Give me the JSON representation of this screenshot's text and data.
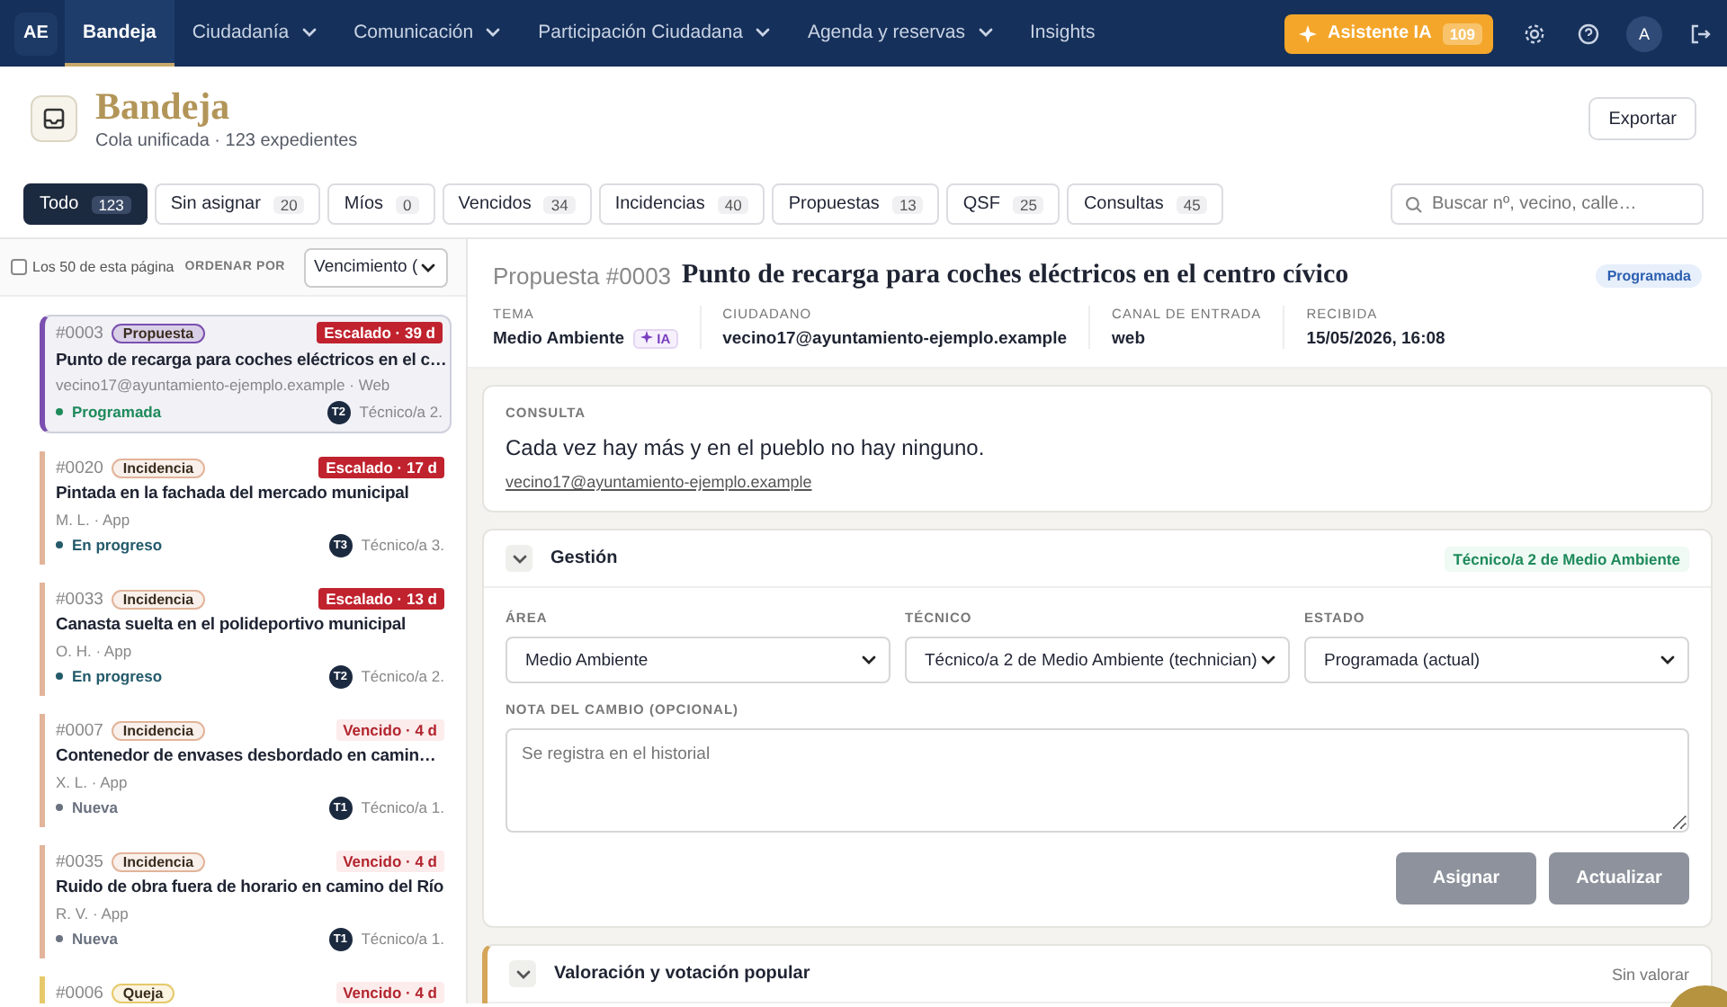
{
  "nav": {
    "logo": "AE",
    "items": [
      {
        "label": "Bandeja",
        "selected": true,
        "has_menu": false
      },
      {
        "label": "Ciudadanía",
        "selected": false,
        "has_menu": true
      },
      {
        "label": "Comunicación",
        "selected": false,
        "has_menu": true
      },
      {
        "label": "Participación Ciudadana",
        "selected": false,
        "has_menu": true
      },
      {
        "label": "Agenda y reservas",
        "selected": false,
        "has_menu": true
      },
      {
        "label": "Insights",
        "selected": false,
        "has_menu": false
      }
    ],
    "assistant": {
      "label": "Asistente IA",
      "count": "109"
    },
    "avatar": "A"
  },
  "header": {
    "title": "Bandeja",
    "subtitle": "Cola unificada · 123 expedientes",
    "export": "Exportar"
  },
  "filters": [
    {
      "label": "Todo",
      "count": "123",
      "selected": true
    },
    {
      "label": "Sin asignar",
      "count": "20",
      "selected": false
    },
    {
      "label": "Míos",
      "count": "0",
      "selected": false
    },
    {
      "label": "Vencidos",
      "count": "34",
      "selected": false
    },
    {
      "label": "Incidencias",
      "count": "40",
      "selected": false
    },
    {
      "label": "Propuestas",
      "count": "13",
      "selected": false
    },
    {
      "label": "QSF",
      "count": "25",
      "selected": false
    },
    {
      "label": "Consultas",
      "count": "45",
      "selected": false
    }
  ],
  "search": {
    "placeholder": "Buscar nº, vecino, calle…"
  },
  "list_toolbar": {
    "select_all": {
      "label": "Los 50 de esta página",
      "checked": false
    },
    "sort_label": "ORDENAR POR",
    "sort_value": "Vencimiento ("
  },
  "items": [
    {
      "id": "#0003",
      "type": "Propuesta",
      "color": "#7b4fb0",
      "sla": {
        "kind": "escalado",
        "text": "Escalado · 39 d"
      },
      "title": "Punto de recarga para coches eléctricos en el c…",
      "sub": "vecino17@ayuntamiento-ejemplo.example · Web",
      "status": {
        "label": "Programada",
        "color": "#1f8a5b"
      },
      "avatar": "T2",
      "assignee": "Técnico/a 2.",
      "selected": true
    },
    {
      "id": "#0020",
      "type": "Incidencia",
      "color": "#e2b49a",
      "sla": {
        "kind": "escalado",
        "text": "Escalado · 17 d"
      },
      "title": "Pintada en la fachada del mercado municipal",
      "sub": "M. L. · App",
      "status": {
        "label": "En progreso",
        "color": "#245b6b"
      },
      "avatar": "T3",
      "assignee": "Técnico/a 3.",
      "selected": false
    },
    {
      "id": "#0033",
      "type": "Incidencia",
      "color": "#e2b49a",
      "sla": {
        "kind": "escalado",
        "text": "Escalado · 13 d"
      },
      "title": "Canasta suelta en el polideportivo municipal",
      "sub": "O. H. · App",
      "status": {
        "label": "En progreso",
        "color": "#245b6b"
      },
      "avatar": "T2",
      "assignee": "Técnico/a 2.",
      "selected": false
    },
    {
      "id": "#0007",
      "type": "Incidencia",
      "color": "#e2b49a",
      "sla": {
        "kind": "vencido",
        "text": "Vencido · 4 d"
      },
      "title": "Contenedor de envases desbordado en camin…",
      "sub": "X. L. · App",
      "status": {
        "label": "Nueva",
        "color": "#6b7280"
      },
      "avatar": "T1",
      "assignee": "Técnico/a 1.",
      "selected": false
    },
    {
      "id": "#0035",
      "type": "Incidencia",
      "color": "#e2b49a",
      "sla": {
        "kind": "vencido",
        "text": "Vencido · 4 d"
      },
      "title": "Ruido de obra fuera de horario en camino del Río",
      "sub": "R. V. · App",
      "status": {
        "label": "Nueva",
        "color": "#6b7280"
      },
      "avatar": "T1",
      "assignee": "Técnico/a 1.",
      "selected": false
    },
    {
      "id": "#0006",
      "type": "Queja",
      "color": "#e6c96a",
      "sla": {
        "kind": "vencido",
        "text": "Vencido · 4 d"
      },
      "selected": false
    }
  ],
  "detail": {
    "kind_label": "Propuesta #0003",
    "title": "Punto de recarga para coches eléctricos en el centro cívico",
    "status": "Programada",
    "meta": [
      {
        "label": "TEMA",
        "value": "Medio Ambiente",
        "badge": "IA"
      },
      {
        "label": "CIUDADANO",
        "value": "vecino17@ayuntamiento-ejemplo.example"
      },
      {
        "label": "CANAL DE ENTRADA",
        "value": "web"
      },
      {
        "label": "RECIBIDA",
        "value": "15/05/2026, 16:08"
      }
    ],
    "consulta": {
      "label": "CONSULTA",
      "text": "Cada vez hay más y en el pueblo no hay ninguno.",
      "link": "vecino17@ayuntamiento-ejemplo.example"
    },
    "gestion": {
      "title": "Gestión",
      "expanded": true,
      "assignee_badge": "Técnico/a 2 de Medio Ambiente",
      "fields": [
        {
          "label": "ÁREA",
          "value": "Medio Ambiente"
        },
        {
          "label": "TÉCNICO",
          "value": "Técnico/a 2 de Medio Ambiente (technician)"
        },
        {
          "label": "ESTADO",
          "value": "Programada (actual)"
        }
      ],
      "note": {
        "label": "NOTA DEL CAMBIO (OPCIONAL)",
        "placeholder": "Se registra en el historial"
      },
      "buttons": [
        {
          "label": "Asignar",
          "disabled": true
        },
        {
          "label": "Actualizar",
          "disabled": true
        }
      ]
    },
    "valoracion": {
      "title": "Valoración y votación popular",
      "expanded": false,
      "status": "Sin valorar"
    }
  }
}
